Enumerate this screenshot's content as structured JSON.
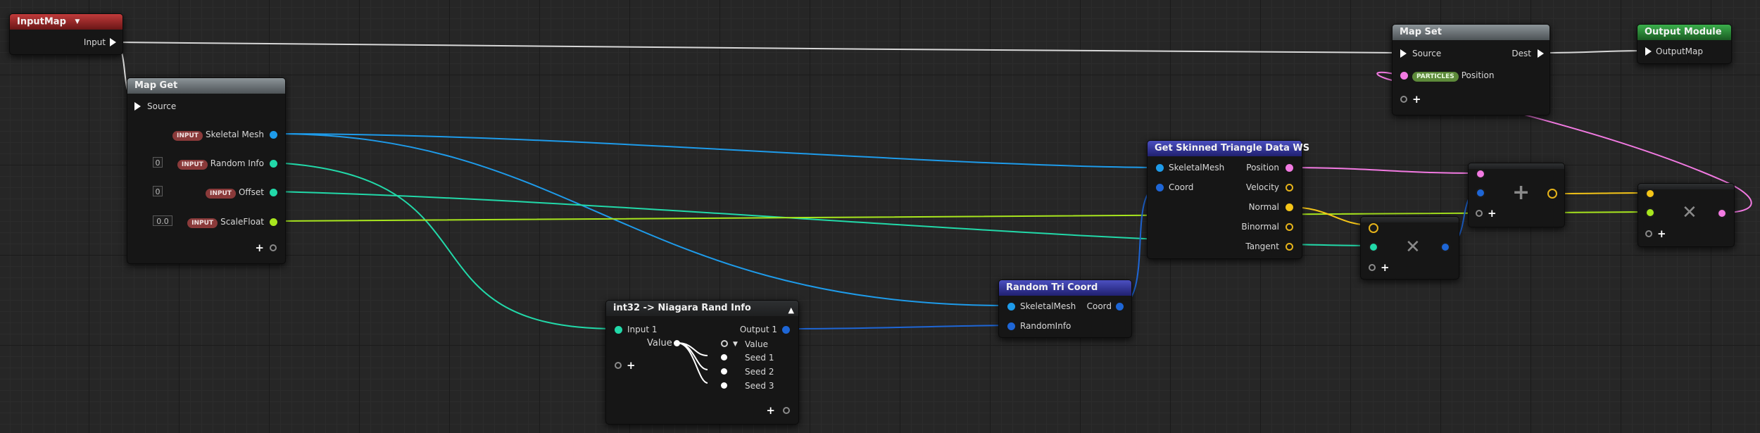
{
  "colors": {
    "exec": "#ffffff",
    "skeletal_mesh": "#1e9bea",
    "random_info": "#22d9a9",
    "float": "#a8e61e",
    "position": "#f27ae2",
    "vector": "#f5c518",
    "coord": "#1e66d6"
  },
  "nodes": {
    "input_map": {
      "title": "InputMap",
      "input_label": "Input",
      "icon": "chevron-down-icon"
    },
    "map_get": {
      "title": "Map Get",
      "source_label": "Source",
      "badge": "INPUT",
      "skeletal_mesh_label": "Skeletal Mesh",
      "random_info_label": "Random Info",
      "random_info_value": "0",
      "offset_label": "Offset",
      "offset_value": "0",
      "scale_label": "ScaleFloat",
      "scale_value": "0.0"
    },
    "map_set": {
      "title": "Map Set",
      "source_label": "Source",
      "dest_label": "Dest",
      "badge": "PARTICLES",
      "position_label": "Position"
    },
    "output_module": {
      "title": "Output Module",
      "output_label": "OutputMap"
    },
    "skinned": {
      "title": "Get Skinned Triangle Data WS",
      "in_skeletal": "SkeletalMesh",
      "in_coord": "Coord",
      "out_position": "Position",
      "out_velocity": "Velocity",
      "out_normal": "Normal",
      "out_binormal": "Binormal",
      "out_tangent": "Tangent"
    },
    "random_tri": {
      "title": "Random Tri Coord",
      "in_skeletal": "SkeletalMesh",
      "in_random": "RandomInfo",
      "out_coord": "Coord"
    },
    "rand_info": {
      "title": "int32 -> Niagara Rand Info",
      "input1": "Input 1",
      "output1": "Output 1",
      "value_label": "Value",
      "out_value": "Value",
      "seed1": "Seed 1",
      "seed2": "Seed 2",
      "seed3": "Seed 3"
    },
    "multiply1": {
      "symbol": "✕"
    },
    "add": {
      "symbol": "+"
    },
    "multiply2": {
      "symbol": "✕"
    }
  }
}
